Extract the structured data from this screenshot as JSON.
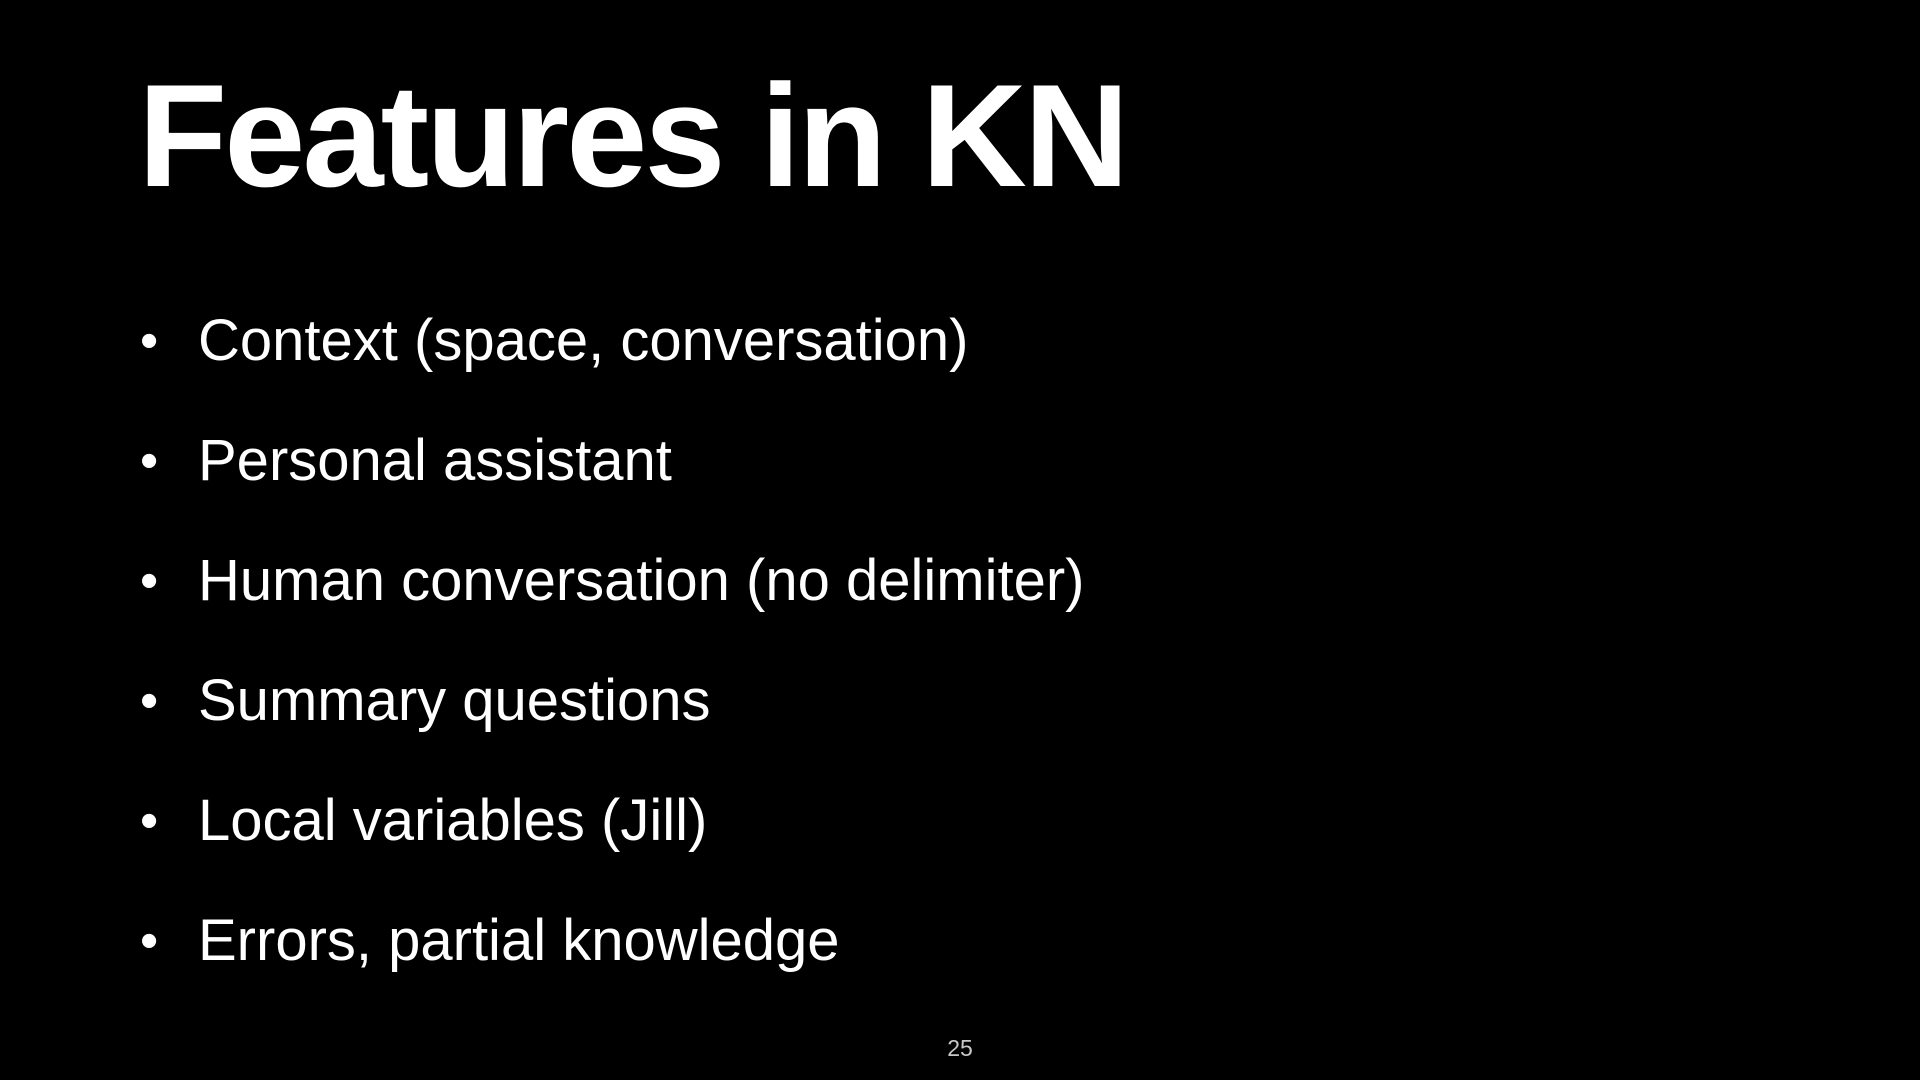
{
  "slide": {
    "title": "Features in KN",
    "bullet_symbol": "•",
    "bullets": [
      "Context (space, conversation)",
      "Personal assistant",
      "Human conversation (no delimiter)",
      "Summary questions",
      "Local variables (Jill)",
      "Errors, partial knowledge"
    ],
    "page_number": "25"
  },
  "colors": {
    "background": "#000000",
    "text": "#ffffff"
  }
}
